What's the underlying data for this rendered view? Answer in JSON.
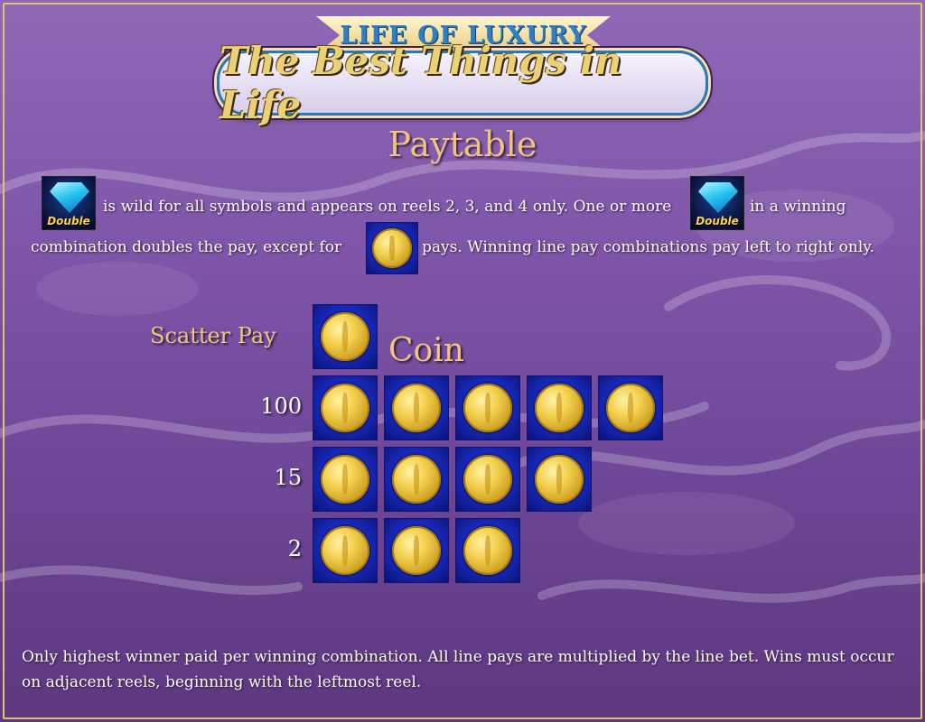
{
  "logo": {
    "top_text": "LIFE OF LUXURY",
    "main_text": "The Best Things in Life"
  },
  "title": "Paytable",
  "intro": {
    "line1_part1": "is wild for all symbols and appears on reels 2, 3, and 4 only. One or more",
    "line1_part2": "in a winning",
    "line2_part1": "combination doubles the pay, except for",
    "line2_part2": "pays. Winning line pay combinations pay left to right only.",
    "wild_symbol_text": "Double"
  },
  "scatter": {
    "label": "Scatter Pay",
    "symbol_name": "Coin",
    "pays": [
      {
        "value": "100",
        "count": 5
      },
      {
        "value": "15",
        "count": 4
      },
      {
        "value": "2",
        "count": 3
      }
    ]
  },
  "footer": "Only highest winner paid per winning combination. All line pays are multiplied by the line bet. Wins must occur on adjacent reels, beginning with the leftmost reel.",
  "colors": {
    "background": "#7e55a8",
    "gold_text": "#f1c579",
    "border": "#e8bf6a",
    "tile_blue": "#1a2cc4"
  },
  "icons": {
    "wild": "double-diamond-icon",
    "scatter": "gold-coin-icon"
  }
}
